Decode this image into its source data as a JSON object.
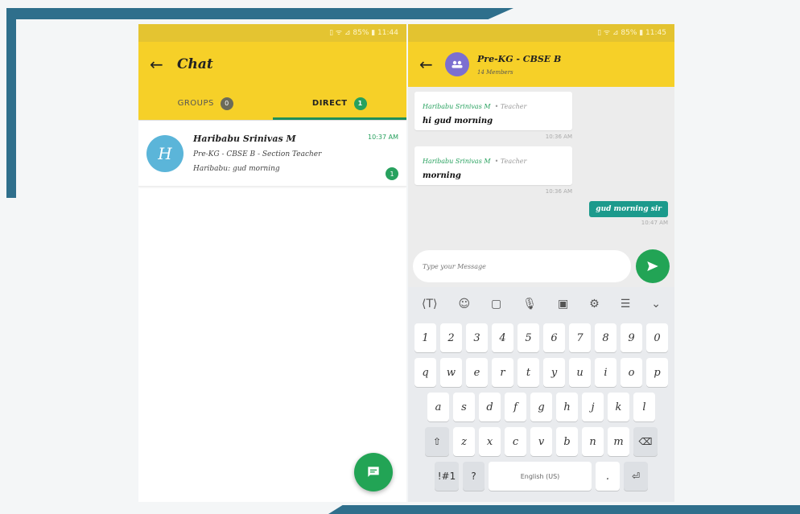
{
  "left": {
    "status_text": "▯ ᯤ ⊿ 85% ▮ 11:44",
    "title": "Chat",
    "tabs": [
      {
        "label": "GROUPS",
        "badge": "0"
      },
      {
        "label": "DIRECT",
        "badge": "1"
      }
    ],
    "conversation": {
      "avatar_letter": "H",
      "name": "Haribabu Srinivas M",
      "subtitle": "Pre-KG - CBSE B - Section Teacher",
      "last_message": "Haribabu: gud morning",
      "time": "10:37 AM",
      "unread": "1"
    }
  },
  "right": {
    "status_text": "▯ ᯤ ⊿ 85% ▮ 11:45",
    "group_name": "Pre-KG - CBSE B",
    "members": "14 Members",
    "messages": [
      {
        "sender": "Haribabu Srinivas M",
        "role": "• Teacher",
        "text": "hi gud morning",
        "time": "10:36 AM"
      },
      {
        "sender": "Haribabu Srinivas M",
        "role": "• Teacher",
        "text": "morning",
        "time": "10:36 AM"
      }
    ],
    "outgoing": {
      "text": "gud morning sir",
      "time": "10:47 AM"
    },
    "input_placeholder": "Type your Message",
    "keyboard": {
      "numbers": [
        "1",
        "2",
        "3",
        "4",
        "5",
        "6",
        "7",
        "8",
        "9",
        "0"
      ],
      "row1": [
        "q",
        "w",
        "e",
        "r",
        "t",
        "y",
        "u",
        "i",
        "o",
        "p"
      ],
      "row2": [
        "a",
        "s",
        "d",
        "f",
        "g",
        "h",
        "j",
        "k",
        "l"
      ],
      "row3": [
        "z",
        "x",
        "c",
        "v",
        "b",
        "n",
        "m"
      ],
      "symbols_key": "!#1",
      "question_key": "?",
      "space_label": "English (US)",
      "period_key": "."
    }
  },
  "colors": {
    "appbar": "#f6d028",
    "accent_green": "#22a455",
    "outgoing_bubble": "#1c9a8c",
    "frame": "#2f6f8c"
  }
}
